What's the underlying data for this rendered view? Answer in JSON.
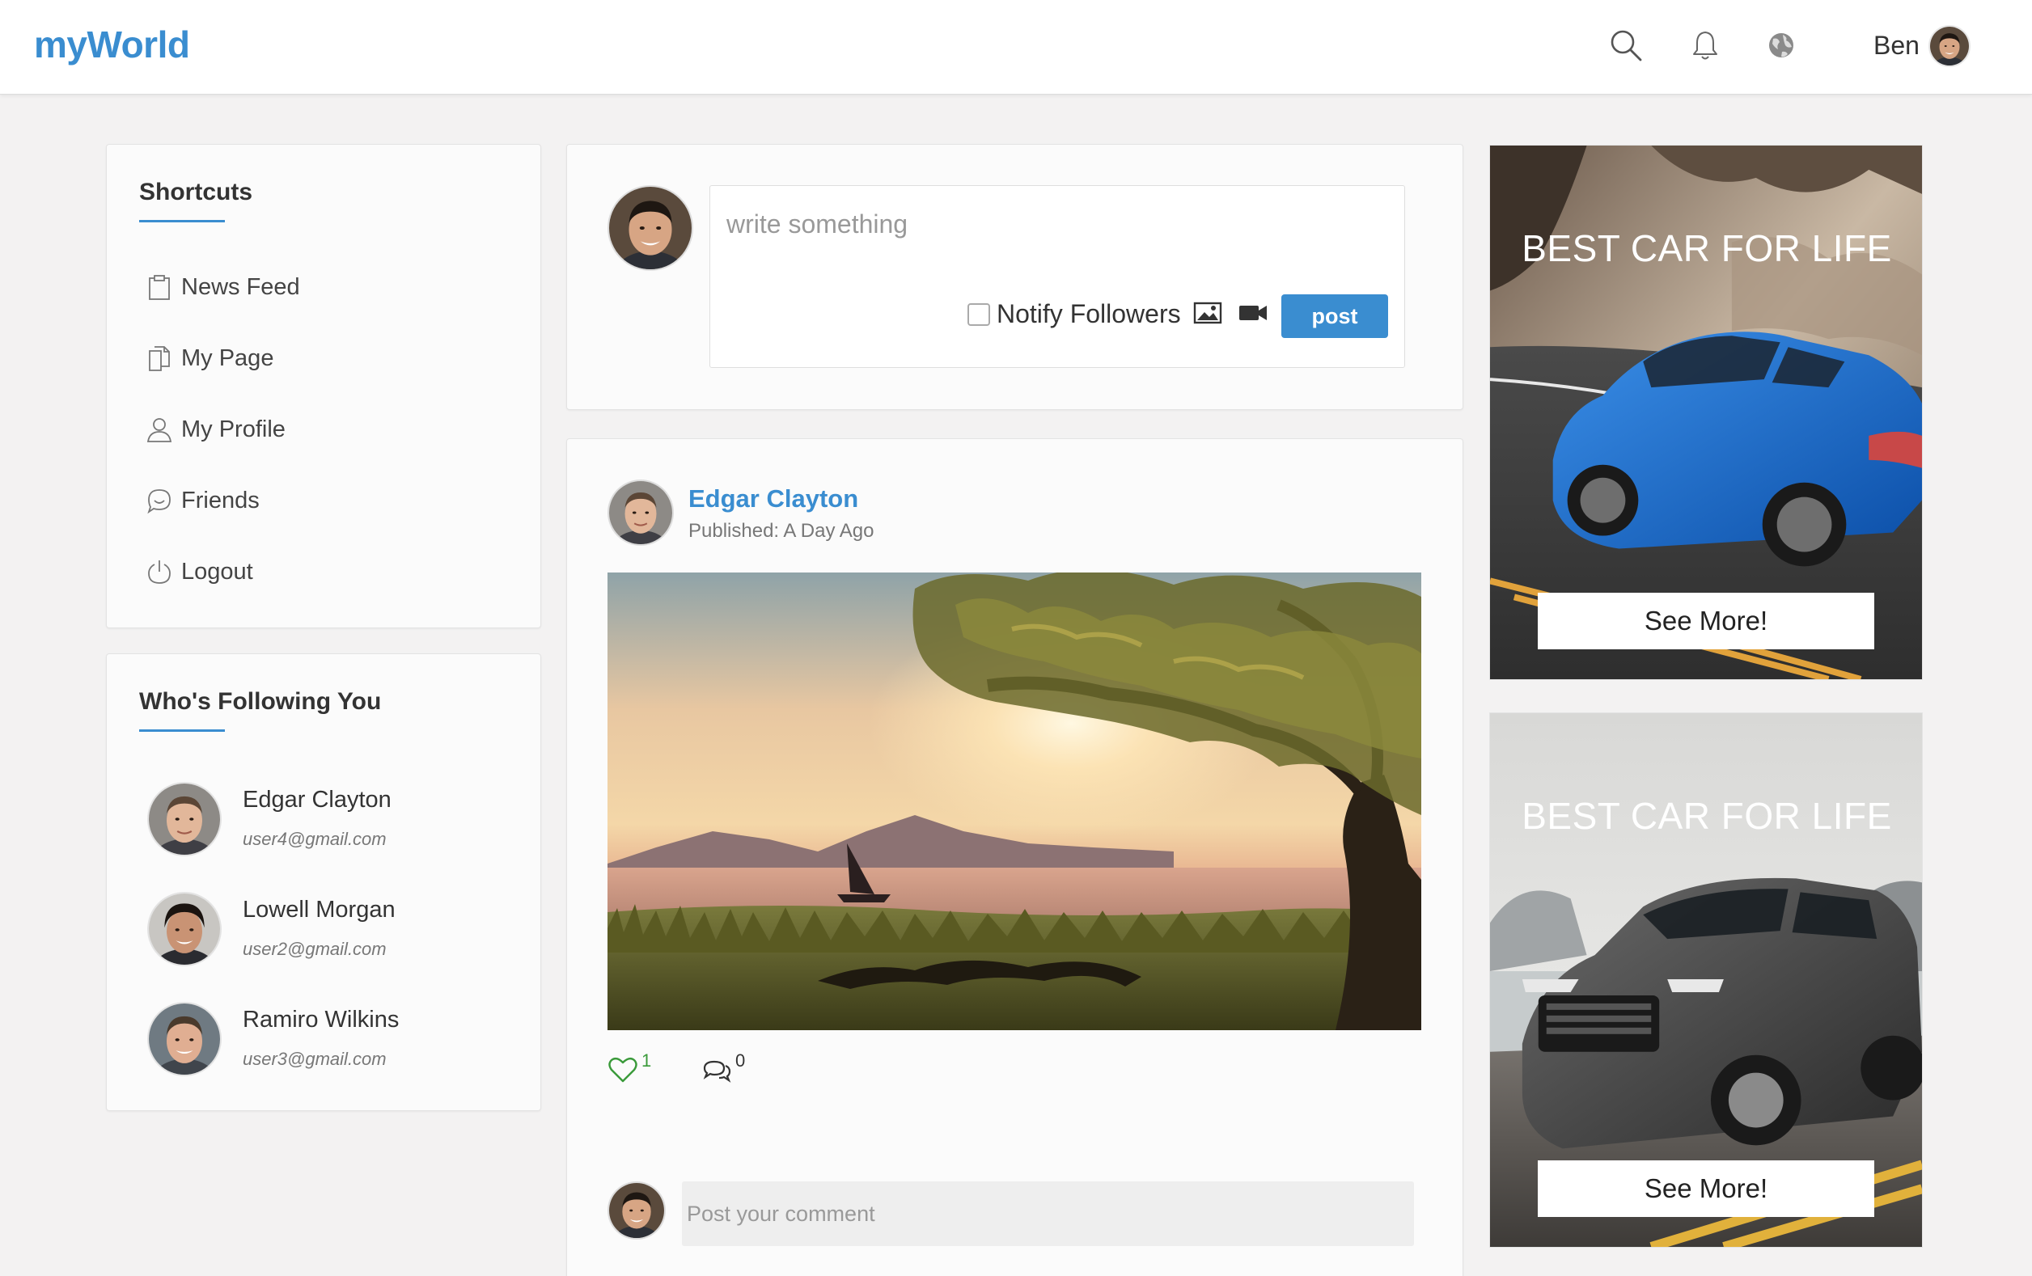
{
  "app": {
    "logo": "myWorld"
  },
  "header": {
    "icons": [
      "search-icon",
      "bell-icon",
      "globe-icon"
    ],
    "user_name": "Ben"
  },
  "shortcuts": {
    "title": "Shortcuts",
    "items": [
      {
        "label": "News Feed",
        "icon": "clipboard-icon"
      },
      {
        "label": "My Page",
        "icon": "pages-icon"
      },
      {
        "label": "My Profile",
        "icon": "user-icon"
      },
      {
        "label": "Friends",
        "icon": "chat-icon"
      },
      {
        "label": "Logout",
        "icon": "power-icon"
      }
    ]
  },
  "followers": {
    "title": "Who's Following You",
    "items": [
      {
        "name": "Edgar Clayton",
        "email": "user4@gmail.com"
      },
      {
        "name": "Lowell Morgan",
        "email": "user2@gmail.com"
      },
      {
        "name": "Ramiro Wilkins",
        "email": "user3@gmail.com"
      }
    ]
  },
  "composer": {
    "placeholder": "write something",
    "notify_label": "Notify Followers",
    "post_label": "post"
  },
  "post": {
    "author": "Edgar Clayton",
    "published": "Published: A Day Ago",
    "likes": "1",
    "comments": "0",
    "comment_placeholder": "Post your comment"
  },
  "ads": [
    {
      "title": "BEST CAR FOR LIFE",
      "button": "See More!"
    },
    {
      "title": "BEST CAR FOR LIFE",
      "button": "See More!"
    }
  ],
  "colors": {
    "accent": "#3a8dd0",
    "background": "#f3f2f2",
    "like": "#3a9a3a"
  }
}
